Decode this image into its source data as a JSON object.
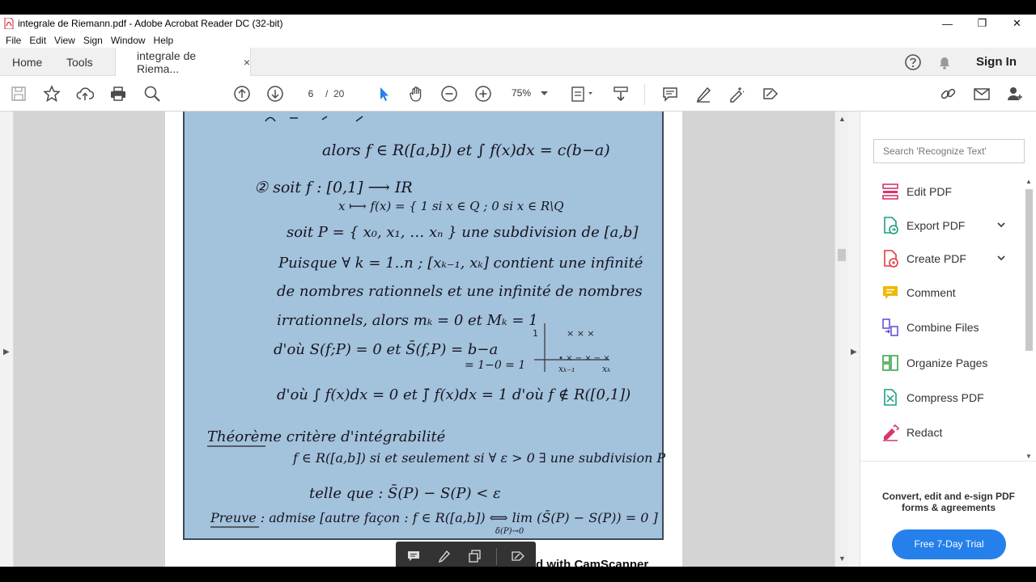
{
  "window": {
    "title": "integrale de Riemann.pdf - Adobe Acrobat Reader DC (32-bit)",
    "minimize_glyph": "—",
    "restore_glyph": "❐",
    "close_glyph": "✕"
  },
  "menu": [
    "File",
    "Edit",
    "View",
    "Sign",
    "Window",
    "Help"
  ],
  "tabs": {
    "home": "Home",
    "tools": "Tools",
    "document": "integrale de Riema...",
    "close_glyph": "×",
    "sign_in": "Sign In"
  },
  "toolbar": {
    "current_page": "6",
    "page_separator": "/",
    "total_pages": "20",
    "zoom": "75%"
  },
  "document": {
    "handwriting": [
      "alors f ∈ R([a,b]) et ∫ f(x)dx = c(b−a)",
      "② soit f : [0,1] ⟶ IR",
      "x ⟼ f(x) = { 1  si x ∈ Q ; 0  si x ∈ R\\Q",
      "soit P = { x₀, x₁, … xₙ } une subdivision de [a,b]",
      "Puisque ∀ k = 1..n ; [xₖ₋₁, xₖ] contient une infinité",
      "de nombres rationnels et une infinité de nombres",
      "irrationnels, alors mₖ = 0 et Mₖ = 1",
      "d'où S(f;P) = 0 et S̄(f,P) = b−a",
      "= 1−0 = 1",
      "d'où ∫ f(x)dx = 0 et ∫̄ f(x)dx = 1  d'où f ∉ R([0,1])",
      "Théorème   critère d'intégrabilité",
      "f ∈ R([a,b]) si et seulement si ∀ ε > 0 ∃ une subdivision P",
      "telle que :  S̄(P) − S(P) < ε",
      "Preuve : admise [autre façon : f ∈ R([a,b]) ⟺ lim (S̄(P) − S(P)) = 0 ]",
      "δ(P)→0"
    ],
    "footer_text": "d with CamScanner"
  },
  "right_panel": {
    "search_placeholder": "Search 'Recognize Text'",
    "tools": [
      {
        "label": "Edit PDF",
        "icon": "edit-pdf-icon",
        "color": "#d9366b"
      },
      {
        "label": "Export PDF",
        "icon": "export-pdf-icon",
        "color": "#1a9e83"
      },
      {
        "label": "Create PDF",
        "icon": "create-pdf-icon",
        "color": "#e03b3b"
      },
      {
        "label": "Comment",
        "icon": "comment-icon",
        "color": "#f2b705"
      },
      {
        "label": "Combine Files",
        "icon": "combine-files-icon",
        "color": "#6b52d6"
      },
      {
        "label": "Organize Pages",
        "icon": "organize-pages-icon",
        "color": "#3aa64b"
      },
      {
        "label": "Compress PDF",
        "icon": "compress-pdf-icon",
        "color": "#1a9e83"
      },
      {
        "label": "Redact",
        "icon": "redact-icon",
        "color": "#d9366b"
      }
    ],
    "promo_text": "Convert, edit and e-sign PDF forms & agreements",
    "trial_button": "Free 7-Day Trial"
  },
  "colors": {
    "accent": "#2680eb",
    "scan_background": "#a3c2dc",
    "toolbar_icon": "#4b4b4b"
  }
}
